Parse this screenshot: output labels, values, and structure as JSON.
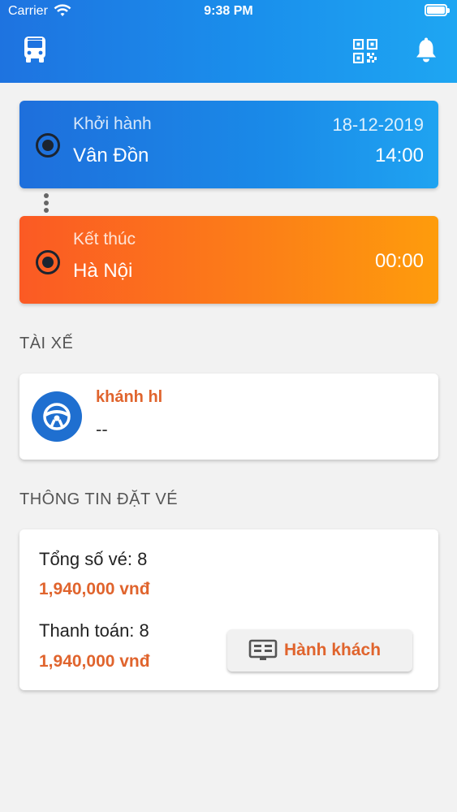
{
  "status_bar": {
    "carrier": "Carrier",
    "time": "9:38 PM"
  },
  "header": {
    "icons": [
      "bus-icon",
      "qr-code-icon",
      "bell-icon"
    ]
  },
  "trip": {
    "start": {
      "label": "Khởi hành",
      "city": "Vân Đồn",
      "date": "18-12-2019",
      "time": "14:00"
    },
    "end": {
      "label": "Kết thúc",
      "city": "Hà Nội",
      "time": "00:00"
    }
  },
  "driver": {
    "section_title": "TÀI XẾ",
    "name": "khánh hl",
    "phone": "--"
  },
  "booking": {
    "section_title": "THÔNG TIN ĐẶT VÉ",
    "total_label": "Tổng số vé: 8",
    "total_price": "1,940,000 vnđ",
    "paid_label": "Thanh toán: 8",
    "paid_price": "1,940,000 vnđ",
    "passenger_button": "Hành khách"
  },
  "colors": {
    "header_blue": "#1a8fec",
    "start_blue": "#1e6fdc",
    "end_orange": "#fb5a24",
    "accent_orange": "#e0642d"
  }
}
